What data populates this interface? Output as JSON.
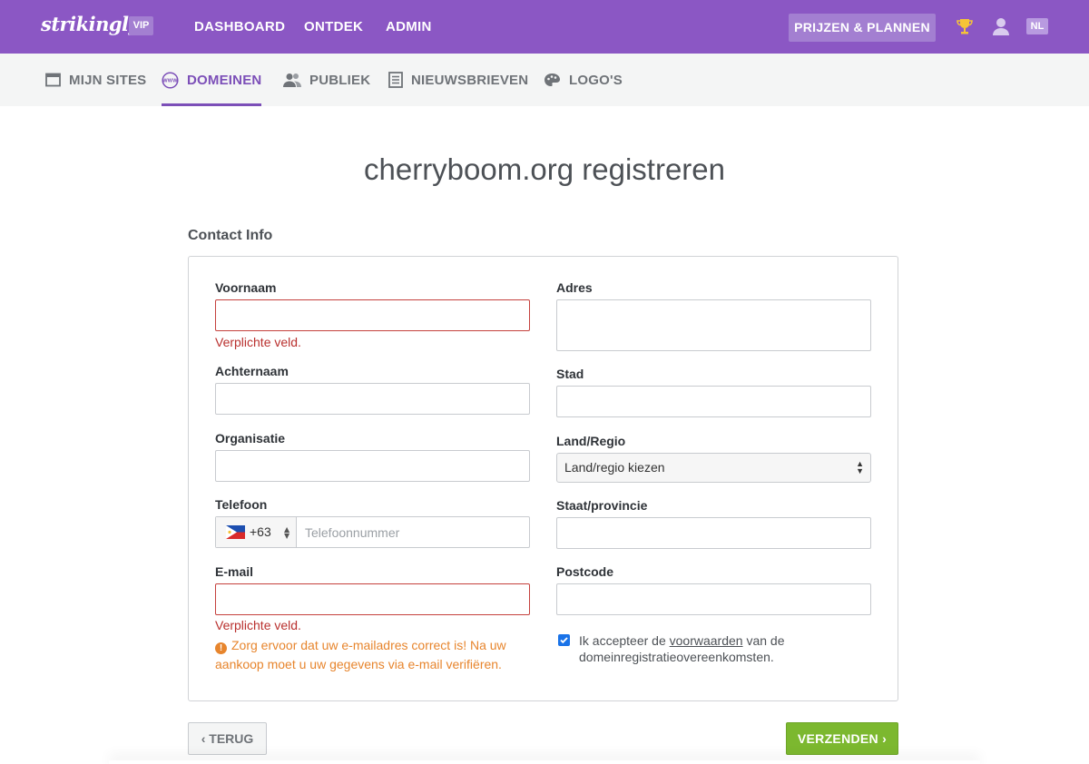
{
  "topbar": {
    "logo": "strikingly",
    "vip": "VIP",
    "nav": [
      "DASHBOARD",
      "ONTDEK",
      "ADMIN"
    ],
    "pricing": "PRIJZEN & PLANNEN",
    "lang": "NL"
  },
  "subnav": {
    "items": [
      {
        "label": "MIJN SITES",
        "icon": "calendar-icon"
      },
      {
        "label": "DOMEINEN",
        "icon": "www-icon",
        "active": true
      },
      {
        "label": "PUBLIEK",
        "icon": "people-icon"
      },
      {
        "label": "NIEUWSBRIEVEN",
        "icon": "newsletter-icon"
      },
      {
        "label": "LOGO'S",
        "icon": "palette-icon"
      }
    ]
  },
  "page": {
    "title": "cherryboom.org registreren",
    "section": "Contact Info"
  },
  "form": {
    "voornaam": {
      "label": "Voornaam",
      "value": "",
      "error": "Verplichte veld."
    },
    "achternaam": {
      "label": "Achternaam",
      "value": ""
    },
    "organisatie": {
      "label": "Organisatie",
      "value": ""
    },
    "telefoon": {
      "label": "Telefoon",
      "country_code": "+63",
      "placeholder": "Telefoonnummer"
    },
    "email": {
      "label": "E-mail",
      "value": "",
      "error": "Verplichte veld.",
      "warning": "Zorg ervoor dat uw e-mailadres correct is! Na uw aankoop moet u uw gegevens via e-mail verifiëren."
    },
    "adres": {
      "label": "Adres",
      "value": ""
    },
    "stad": {
      "label": "Stad",
      "value": ""
    },
    "land": {
      "label": "Land/Regio",
      "selected": "Land/regio kiezen"
    },
    "staat": {
      "label": "Staat/provincie",
      "value": ""
    },
    "postcode": {
      "label": "Postcode",
      "value": ""
    },
    "terms": {
      "checked": true,
      "prefix": "Ik accepteer de ",
      "link": "voorwaarden",
      "suffix": " van de domeinregistratieovereenkomsten."
    }
  },
  "buttons": {
    "back": "TERUG",
    "submit": "VERZENDEN"
  },
  "colors": {
    "topbar": "#8b57c4",
    "accent": "#7c4fb8",
    "error": "#b9302e",
    "warning": "#e7852d",
    "submit": "#7cb82f"
  }
}
